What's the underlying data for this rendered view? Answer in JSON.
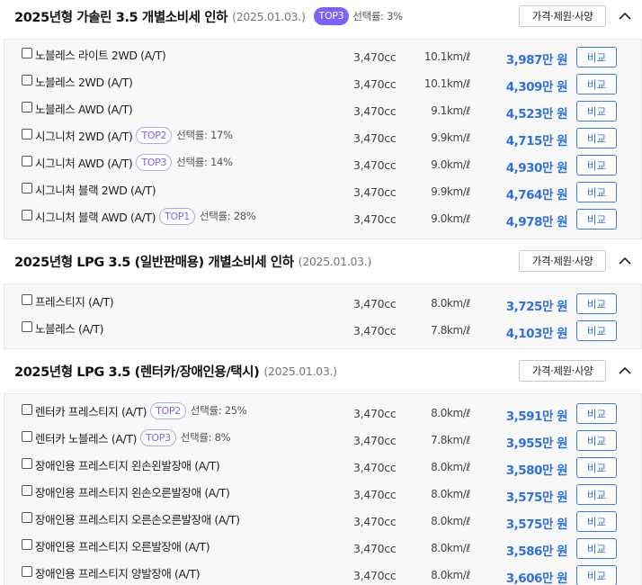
{
  "sections": [
    {
      "title": "2025년형 가솔린 3.5 개별소비세 인하",
      "date": "(2025.01.03.)",
      "badge": "TOP3",
      "rate": "선택률: 3%",
      "spec_label": "가격·제원·사양",
      "rows": [
        {
          "name": "노블레스 라이트 2WD (A/T)",
          "badge": "",
          "rate": "",
          "cc": "3,470cc",
          "eff": "10.1km/ℓ",
          "price": "3,987만 원",
          "compare": "비교"
        },
        {
          "name": "노블레스 2WD (A/T)",
          "badge": "",
          "rate": "",
          "cc": "3,470cc",
          "eff": "10.1km/ℓ",
          "price": "4,309만 원",
          "compare": "비교"
        },
        {
          "name": "노블레스 AWD (A/T)",
          "badge": "",
          "rate": "",
          "cc": "3,470cc",
          "eff": "9.1km/ℓ",
          "price": "4,523만 원",
          "compare": "비교"
        },
        {
          "name": "시그니처 2WD (A/T)",
          "badge": "TOP2",
          "rate": "선택률: 17%",
          "cc": "3,470cc",
          "eff": "9.9km/ℓ",
          "price": "4,715만 원",
          "compare": "비교"
        },
        {
          "name": "시그니처 AWD (A/T)",
          "badge": "TOP3",
          "rate": "선택률: 14%",
          "cc": "3,470cc",
          "eff": "9.0km/ℓ",
          "price": "4,930만 원",
          "compare": "비교"
        },
        {
          "name": "시그니처 블랙 2WD (A/T)",
          "badge": "",
          "rate": "",
          "cc": "3,470cc",
          "eff": "9.9km/ℓ",
          "price": "4,764만 원",
          "compare": "비교"
        },
        {
          "name": "시그니처 블랙 AWD (A/T)",
          "badge": "TOP1",
          "rate": "선택률: 28%",
          "cc": "3,470cc",
          "eff": "9.0km/ℓ",
          "price": "4,978만 원",
          "compare": "비교"
        }
      ]
    },
    {
      "title": "2025년형 LPG 3.5 (일반판매용) 개별소비세 인하",
      "date": "(2025.01.03.)",
      "badge": "",
      "rate": "",
      "spec_label": "가격·제원·사양",
      "rows": [
        {
          "name": "프레스티지 (A/T)",
          "badge": "",
          "rate": "",
          "cc": "3,470cc",
          "eff": "8.0km/ℓ",
          "price": "3,725만 원",
          "compare": "비교"
        },
        {
          "name": "노블레스 (A/T)",
          "badge": "",
          "rate": "",
          "cc": "3,470cc",
          "eff": "7.8km/ℓ",
          "price": "4,103만 원",
          "compare": "비교"
        }
      ]
    },
    {
      "title": "2025년형 LPG 3.5 (렌터카/장애인용/택시)",
      "date": "(2025.01.03.)",
      "badge": "",
      "rate": "",
      "spec_label": "가격·제원·사양",
      "rows": [
        {
          "name": "렌터카 프레스티지 (A/T)",
          "badge": "TOP2",
          "rate": "선택률: 25%",
          "cc": "3,470cc",
          "eff": "8.0km/ℓ",
          "price": "3,591만 원",
          "compare": "비교"
        },
        {
          "name": "렌터카 노블레스 (A/T)",
          "badge": "TOP3",
          "rate": "선택률: 8%",
          "cc": "3,470cc",
          "eff": "7.8km/ℓ",
          "price": "3,955만 원",
          "compare": "비교"
        },
        {
          "name": "장애인용 프레스티지 왼손왼발장애 (A/T)",
          "badge": "",
          "rate": "",
          "cc": "3,470cc",
          "eff": "8.0km/ℓ",
          "price": "3,580만 원",
          "compare": "비교"
        },
        {
          "name": "장애인용 프레스티지 왼손오른발장애 (A/T)",
          "badge": "",
          "rate": "",
          "cc": "3,470cc",
          "eff": "8.0km/ℓ",
          "price": "3,575만 원",
          "compare": "비교"
        },
        {
          "name": "장애인용 프레스티지 오른손오른발장애 (A/T)",
          "badge": "",
          "rate": "",
          "cc": "3,470cc",
          "eff": "8.0km/ℓ",
          "price": "3,575만 원",
          "compare": "비교"
        },
        {
          "name": "장애인용 프레스티지 오른발장애 (A/T)",
          "badge": "",
          "rate": "",
          "cc": "3,470cc",
          "eff": "8.0km/ℓ",
          "price": "3,586만 원",
          "compare": "비교"
        },
        {
          "name": "장애인용 프레스티지 양발장애 (A/T)",
          "badge": "",
          "rate": "",
          "cc": "3,470cc",
          "eff": "8.0km/ℓ",
          "price": "3,606만 원",
          "compare": "비교"
        }
      ]
    }
  ],
  "colors": {
    "accent": "#2d6fe8",
    "badge_purple": "#7b61ff",
    "row_background": "#f8f8f8"
  },
  "icons": {
    "collapse": "chevron-up-icon",
    "checkbox": "checkbox-icon"
  }
}
